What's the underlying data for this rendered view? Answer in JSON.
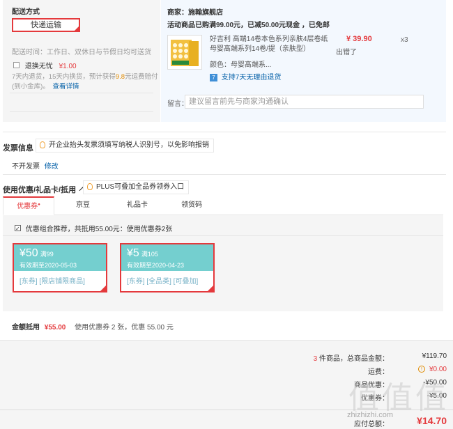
{
  "shipping": {
    "title": "配送方式",
    "option": "快递运输",
    "time_note": "配送时间：工作日、双休日与节假日均可送货",
    "return_label": "退换无忧",
    "return_price": "¥1.00",
    "return_desc_1": "7天内退货，15天内换货，预计获得",
    "return_desc_amount": "9.8",
    "return_desc_2": "元运费赔付",
    "return_desc_3": "(到小金库)。",
    "detail_link": "查看详情"
  },
  "seller": {
    "label": "商家：",
    "name": "施翰旗舰店",
    "promo": "活动商品已购满99.00元，已减50.00元现金 ，已免邮",
    "product_title_1": "好吉利 高端14卷本色系列亲肤4层卷纸",
    "product_title_2": "母婴高端系列14卷/提（亲肤型）",
    "price": "¥ 39.90",
    "qty": "x3",
    "stock": "出错了",
    "color_label": "颜色：",
    "color_value": "母婴高端系...",
    "return_tag": "7",
    "return_policy": "支持7天无理由退货",
    "msg_label": "留言：",
    "msg_placeholder": "建议留言前先与商家沟通确认"
  },
  "invoice": {
    "title": "发票信息",
    "tip": "开企业抬头发票须填写纳税人识别号，以免影响报销",
    "status": "不开发票",
    "edit": "修改"
  },
  "discount": {
    "title": "使用优惠/礼品卡/抵用",
    "arrow": "^",
    "tip": "PLUS可叠加全品券领券入口",
    "tabs": [
      "优惠券",
      "京豆",
      "礼品卡",
      "领货码"
    ],
    "tab_badge": "●",
    "combo_note": "优惠组合推荐，共抵用55.00元：使用优惠券2张",
    "coupons": [
      {
        "amount": "¥50",
        "cond": "满99",
        "expiry": "有效期至2020-05-03",
        "tags": "[东券] [限店铺限商品]"
      },
      {
        "amount": "¥5",
        "cond": "满105",
        "expiry": "有效期至2020-04-23",
        "tags": "[东券] [全品类] [可叠加]"
      }
    ],
    "deduct_label": "金额抵用",
    "deduct_amount": "¥55.00",
    "deduct_note": "使用优惠券 2 张，优惠 55.00 元"
  },
  "summary": {
    "count": "3",
    "count_text": "件商品，总商品金额：",
    "total_goods": "¥119.70",
    "freight_label": "运费：",
    "freight": "¥0.00",
    "row3_label": "商品优惠：",
    "row3_value": "-¥50.00",
    "row4_label": "优惠券：",
    "row4_value": "-¥5.00",
    "payable_label": "应付总额：",
    "payable": "¥14.70"
  },
  "watermark": {
    "logo": "值值值",
    "site": "zhizhizhi.com"
  },
  "colors": {
    "accent": "#e4393c",
    "link": "#005ea7",
    "coupon": "#74cfcf"
  }
}
